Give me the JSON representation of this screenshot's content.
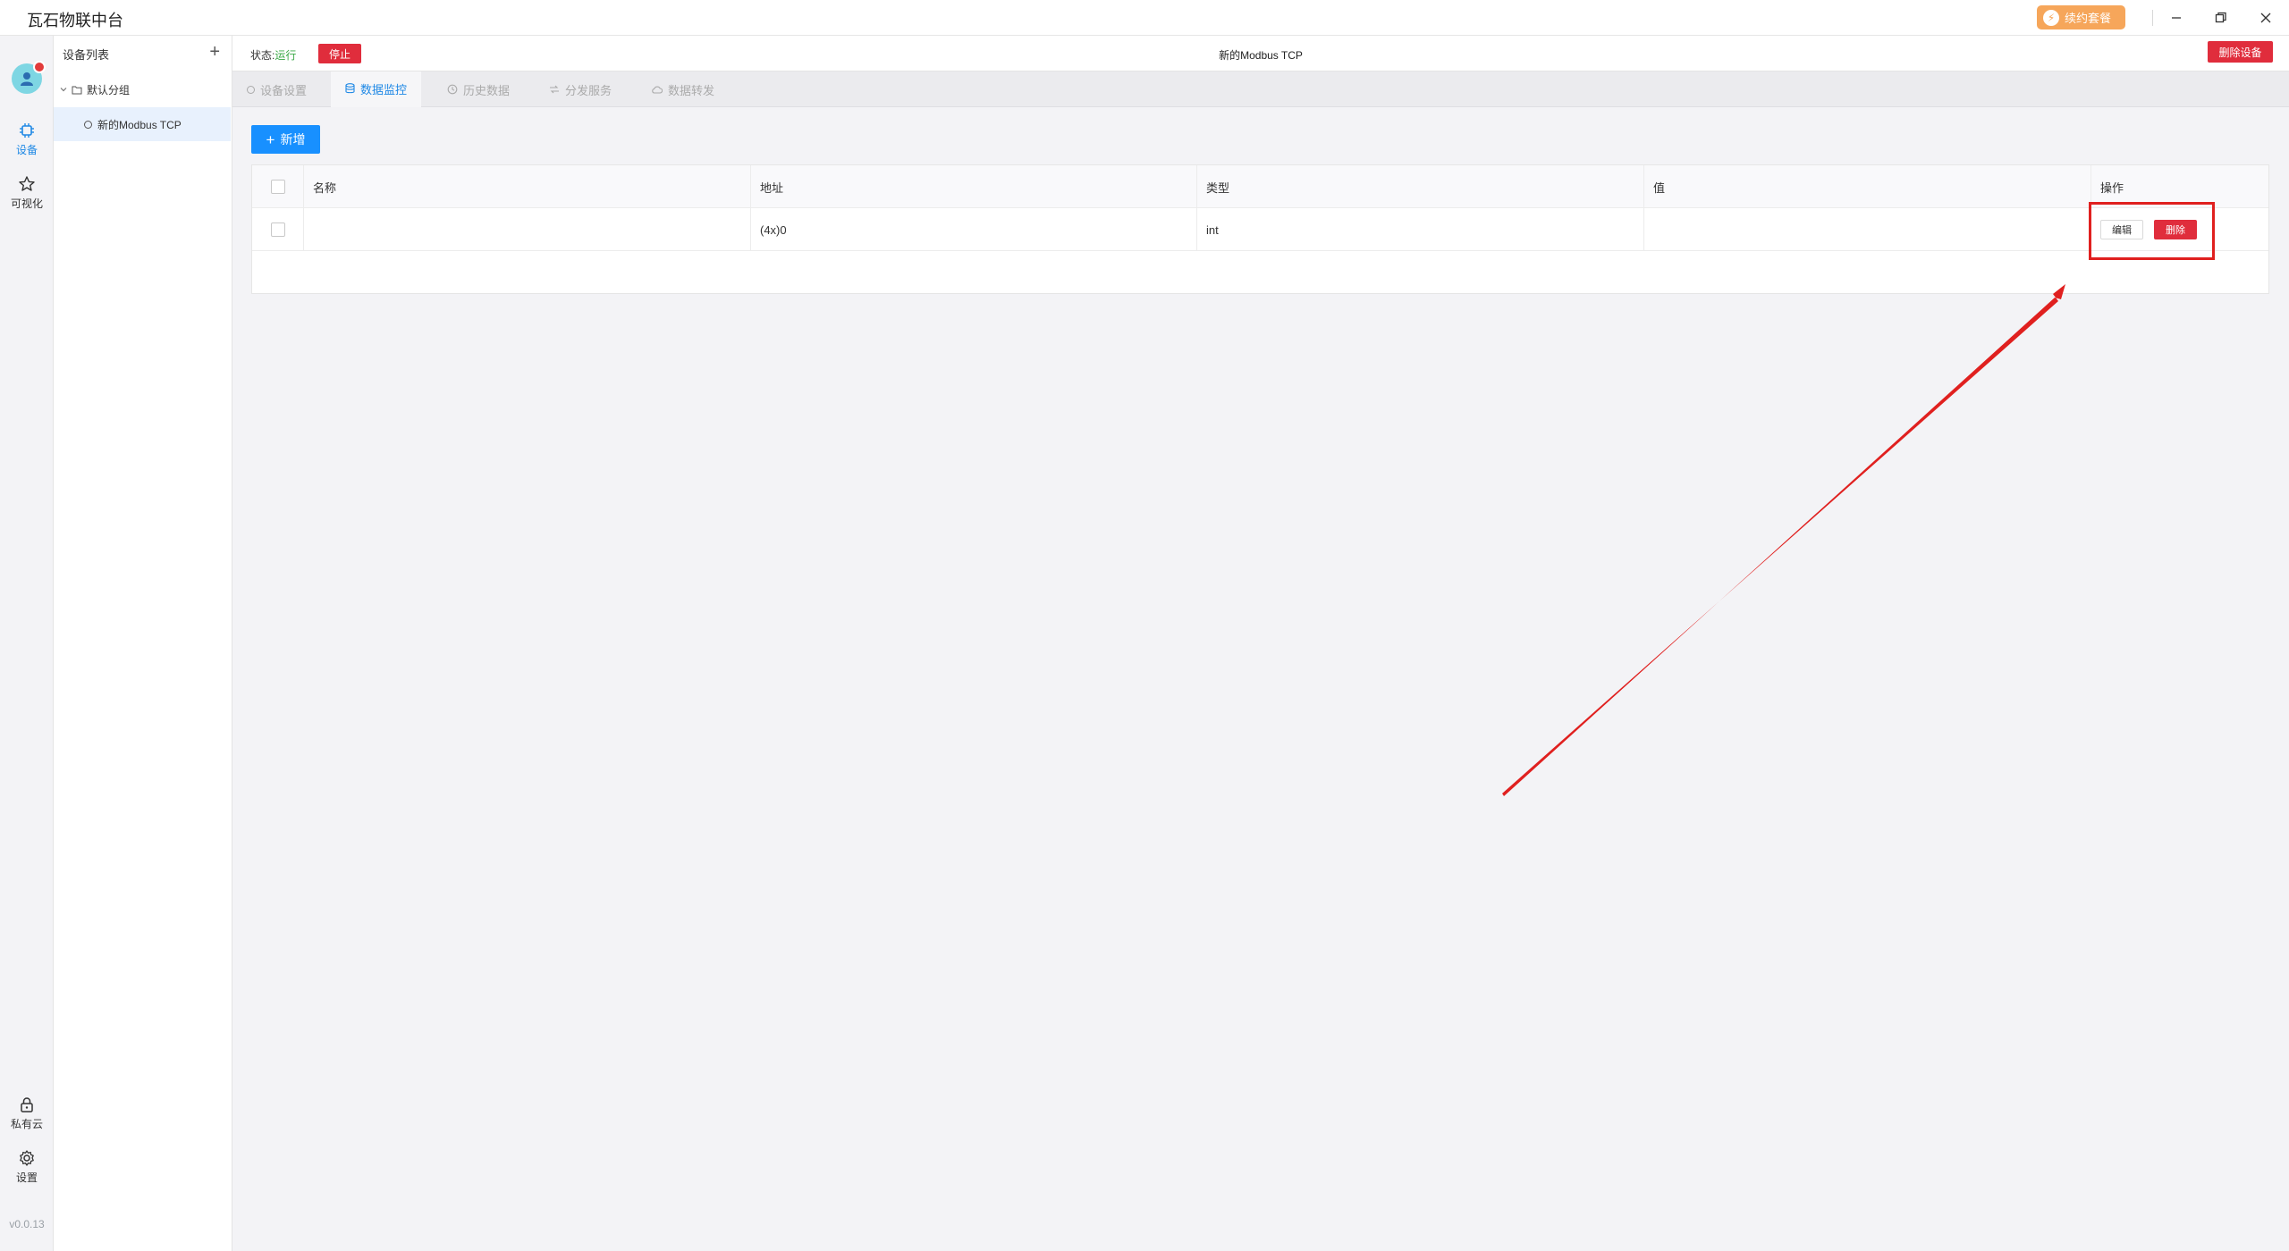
{
  "app": {
    "title": "瓦石物联中台"
  },
  "titlebar": {
    "renew_label": "续约套餐"
  },
  "leftnav": {
    "items": [
      {
        "label": "设备"
      },
      {
        "label": "可视化"
      },
      {
        "label": "私有云"
      },
      {
        "label": "设置"
      }
    ],
    "version": "v0.0.13"
  },
  "device_sidebar": {
    "title": "设备列表",
    "group": "默认分组",
    "device": "新的Modbus TCP"
  },
  "statusbar": {
    "status_label": "状态:",
    "status_value": "运行",
    "stop_label": "停止",
    "device_name": "新的Modbus TCP",
    "delete_device_label": "删除设备"
  },
  "tabs": [
    {
      "label": "设备设置"
    },
    {
      "label": "数据监控"
    },
    {
      "label": "历史数据"
    },
    {
      "label": "分发服务"
    },
    {
      "label": "数据转发"
    }
  ],
  "toolbar": {
    "add_label": "新增"
  },
  "table": {
    "columns": [
      "名称",
      "地址",
      "类型",
      "值",
      "操作"
    ],
    "rows": [
      {
        "name": "",
        "address": "(4x)0",
        "type": "int",
        "value": "",
        "edit_label": "编辑",
        "delete_label": "删除"
      }
    ]
  },
  "colors": {
    "accent": "#1890ff",
    "danger": "#e02d3c",
    "status_green": "#3aa845",
    "annotation": "#e0201f"
  }
}
